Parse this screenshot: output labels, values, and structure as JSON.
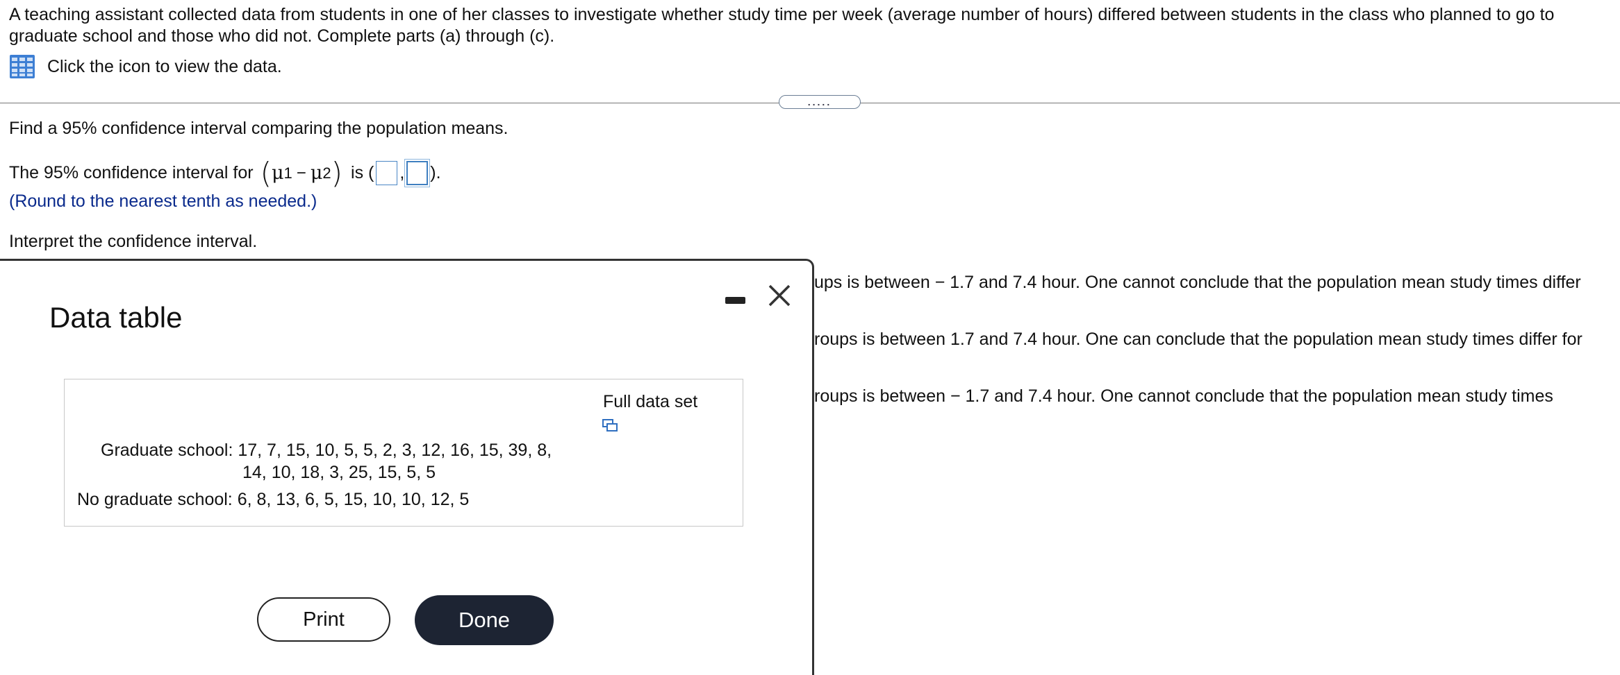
{
  "problem": {
    "intro": "A teaching assistant collected data from students in one of her classes to investigate whether study time per week (average number of hours) differed between students in the class who planned to go to graduate school and those who did not. Complete parts (a) through (c).",
    "data_link": "Click the icon to view the data.",
    "more_button": "....."
  },
  "part": {
    "prompt": "Find a 95% confidence interval comparing the population means.",
    "ci_prefix": "The 95% confidence interval for",
    "mu1": "μ",
    "sub1": "1",
    "minus": "−",
    "mu2": "μ",
    "sub2": "2",
    "ci_is": "is (",
    "comma": ",",
    "ci_close": ").",
    "round_note": "(Round to the nearest tenth as needed.)",
    "interpret_prompt": "Interpret the confidence interval."
  },
  "options_visible_fragments": [
    "ups is between  − 1.7 and 7.4 hour. One cannot conclude that the population mean study times differ",
    "roups is between 1.7 and 7.4 hour. One can conclude that the population mean study times differ for",
    "roups is between  − 1.7 and 7.4 hour. One cannot conclude that the population mean study times"
  ],
  "modal": {
    "title": "Data table",
    "full_data_label": "Full data set",
    "graduate_label": "Graduate school:",
    "graduate_values_line1": "17, 7, 15, 10, 5, 5, 2, 3, 12, 16, 15, 39, 8,",
    "graduate_values_line2": "14, 10, 18, 3, 25, 15, 5, 5",
    "no_graduate_label": "No graduate school:",
    "no_graduate_values": "6, 8, 13, 6, 5, 15, 10, 10, 12, 5",
    "print_label": "Print",
    "done_label": "Done"
  },
  "colors": {
    "accent_blue": "#0a2a8c",
    "done_bg": "#1d2433",
    "input_border": "#4a86c5"
  },
  "icons": [
    "table-icon",
    "minimize-icon",
    "close-icon",
    "copy-icon"
  ]
}
